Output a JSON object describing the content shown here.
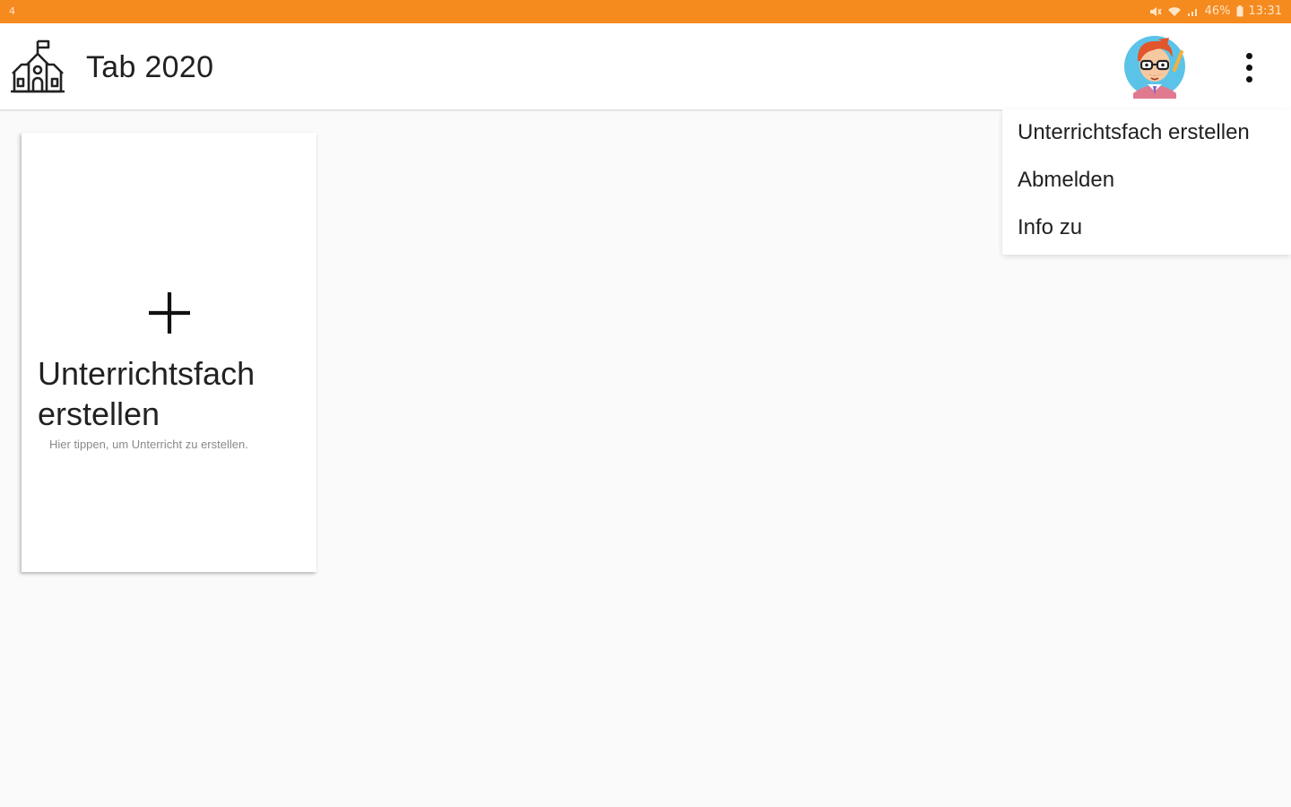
{
  "status_bar": {
    "left_indicator": "4",
    "battery_text": "46%",
    "time": "13:31"
  },
  "app_bar": {
    "logo_icon": "school-building-icon",
    "title": "Tab 2020",
    "avatar_icon": "teacher-avatar-icon",
    "overflow_icon": "more-vert-icon"
  },
  "menu": {
    "items": [
      {
        "label": "Unterrichtsfach erstellen"
      },
      {
        "label": "Abmelden"
      },
      {
        "label": "Info zu"
      }
    ]
  },
  "card": {
    "icon": "plus-icon",
    "title": "Unterrichtsfach erstellen",
    "hint": "Hier tippen, um Unterricht zu erstellen."
  },
  "colors": {
    "status_bar": "#f58a1f",
    "background": "#fafafa",
    "surface": "#ffffff",
    "text": "#212121"
  }
}
